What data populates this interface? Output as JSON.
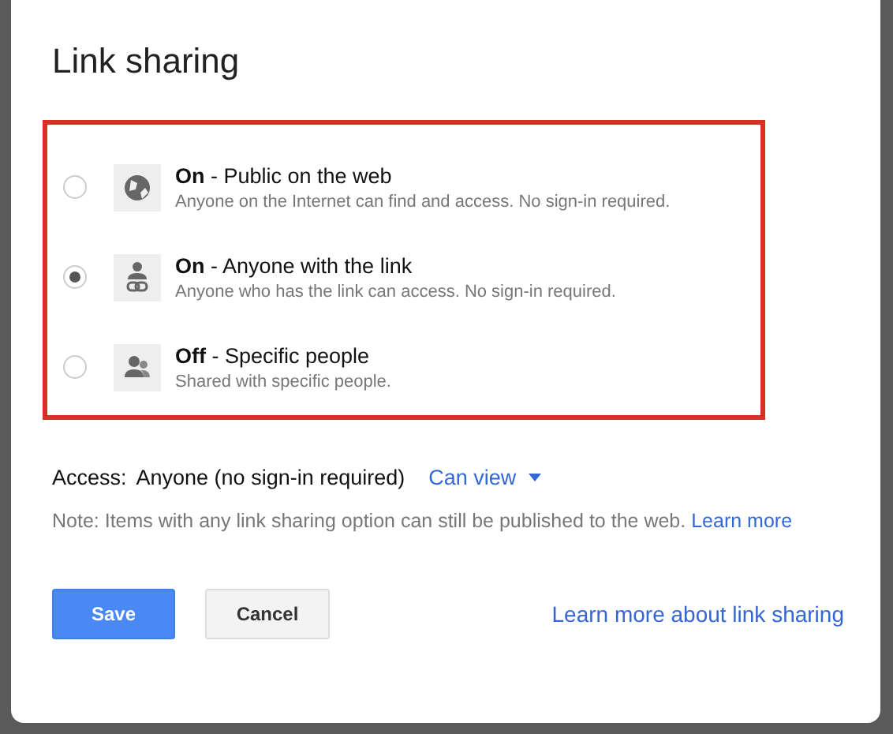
{
  "dialog": {
    "title": "Link sharing"
  },
  "options": [
    {
      "kind": "globe",
      "label": "**On** - Public on the web",
      "description": "Anyone on the Internet can find and access. No sign-in required.",
      "selected": false
    },
    {
      "kind": "link-person",
      "label": "**On** - Anyone with the link",
      "description": "Anyone who has the link can access. No sign-in required.",
      "selected": true
    },
    {
      "kind": "people",
      "label": "**Off** - Specific people",
      "description": "Shared with specific people.",
      "selected": false
    }
  ],
  "access": {
    "label": "Access:",
    "value": "Anyone (no sign-in required)",
    "permission": "Can view"
  },
  "note": {
    "text": "Note: Items with any link sharing option can still be published to the web.",
    "link": "Learn more"
  },
  "buttons": [
    {
      "kind": "primary",
      "label": "Save"
    },
    {
      "kind": "secondary",
      "label": "Cancel"
    }
  ],
  "help_link": "Learn more about link sharing"
}
